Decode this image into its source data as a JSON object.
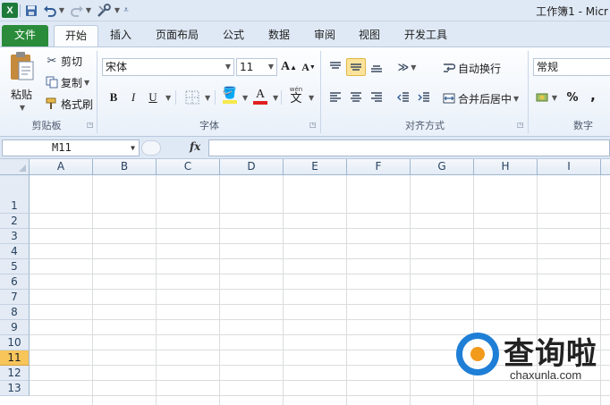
{
  "app": {
    "window_title": "工作簿1 - Micr",
    "logo_letter": "X"
  },
  "quick_access": {
    "icons": [
      "save-icon",
      "undo-icon",
      "redo-icon",
      "customize-icon"
    ]
  },
  "tabs": [
    {
      "label": "文件"
    },
    {
      "label": "开始"
    },
    {
      "label": "插入"
    },
    {
      "label": "页面布局"
    },
    {
      "label": "公式"
    },
    {
      "label": "数据"
    },
    {
      "label": "审阅"
    },
    {
      "label": "视图"
    },
    {
      "label": "开发工具"
    }
  ],
  "ribbon": {
    "clipboard": {
      "group_label": "剪贴板",
      "paste_label": "粘贴",
      "cut_label": "剪切",
      "copy_label": "复制",
      "format_painter_label": "格式刷"
    },
    "font": {
      "group_label": "字体",
      "font_name": "宋体",
      "font_size": "11",
      "bold": "B",
      "italic": "I",
      "underline": "U",
      "grow": "A",
      "shrink": "A",
      "font_color_letter": "A",
      "wen_letter": "文",
      "font_color_hex": "#e02020",
      "fill_color_hex": "#f5e84a"
    },
    "alignment": {
      "group_label": "对齐方式",
      "wrap_text_label": "自动换行",
      "merge_center_label": "合并后居中"
    },
    "number": {
      "group_label": "数字",
      "format": "常规",
      "percent": "%",
      "comma": ","
    }
  },
  "formula_bar": {
    "name_box": "M11",
    "fx_label": "fx",
    "formula": ""
  },
  "sheet": {
    "columns": [
      "A",
      "B",
      "C",
      "D",
      "E",
      "F",
      "G",
      "H",
      "I"
    ],
    "rows": [
      "1",
      "2",
      "3",
      "4",
      "5",
      "6",
      "7",
      "8",
      "9",
      "10",
      "11",
      "12",
      "13"
    ],
    "selected_row": "11"
  },
  "watermark": {
    "text": "查询啦",
    "domain": "chaxunla.com"
  }
}
